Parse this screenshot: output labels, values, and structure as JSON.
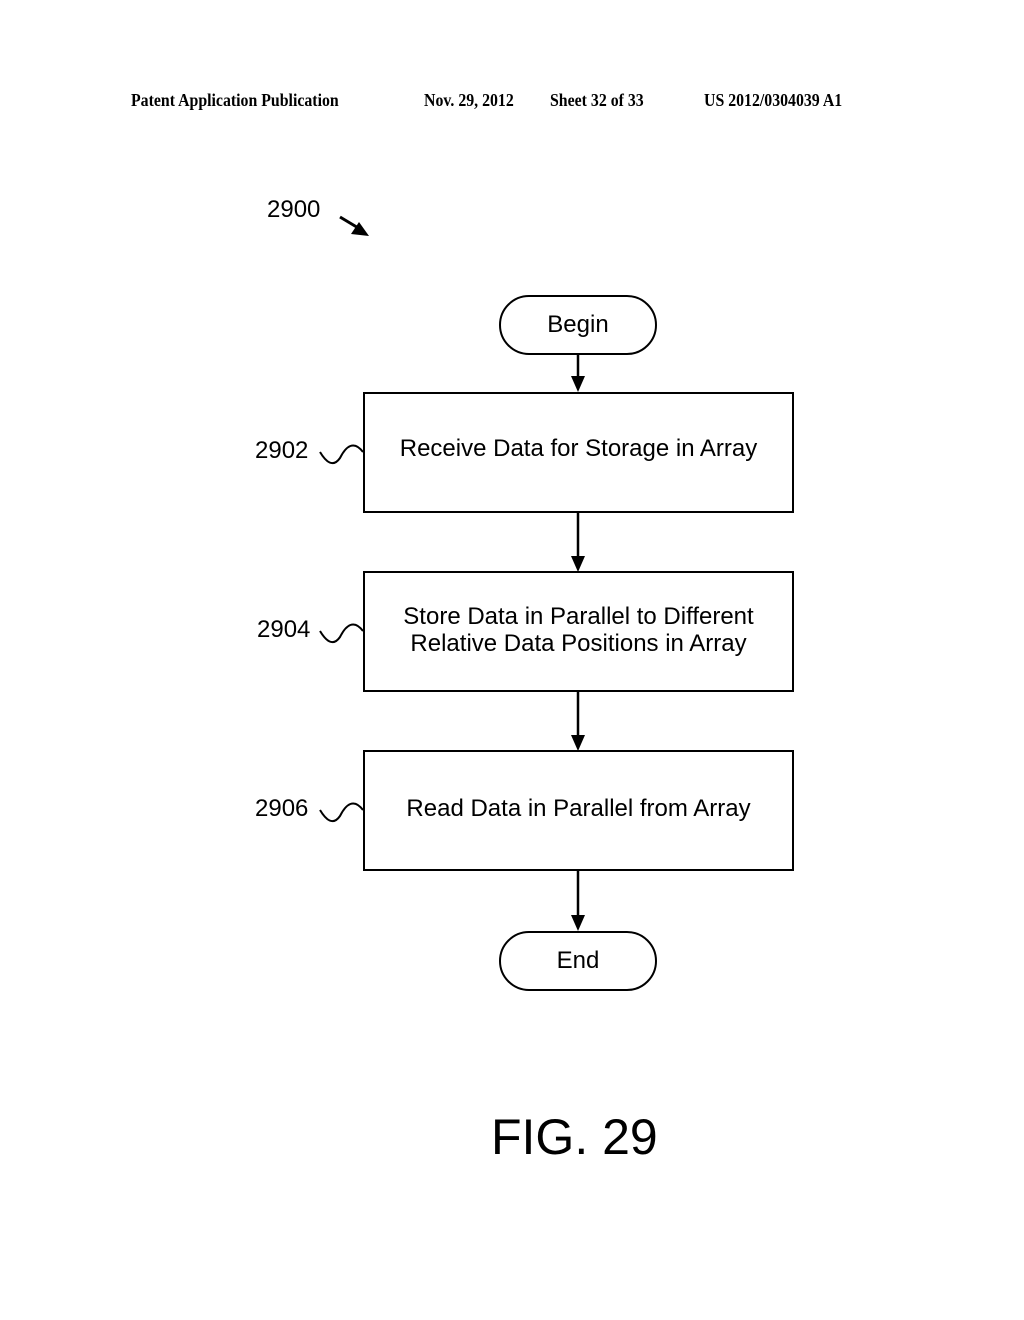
{
  "header": {
    "publication": "Patent Application Publication",
    "date": "Nov. 29, 2012",
    "sheet": "Sheet 32 of 33",
    "number": "US 2012/0304039 A1"
  },
  "figure": {
    "ref_label": "2900",
    "caption": "FIG. 29"
  },
  "flowchart": {
    "begin": "Begin",
    "end": "End",
    "steps": [
      {
        "ref": "2902",
        "lines": [
          "Receive Data for Storage in Array"
        ]
      },
      {
        "ref": "2904",
        "lines": [
          "Store Data in Parallel to Different",
          "Relative Data Positions in Array"
        ]
      },
      {
        "ref": "2906",
        "lines": [
          "Read Data in Parallel from Array"
        ]
      }
    ],
    "edges": [
      {
        "from": "begin",
        "to": "2902"
      },
      {
        "from": "2902",
        "to": "2904"
      },
      {
        "from": "2904",
        "to": "2906"
      },
      {
        "from": "2906",
        "to": "end"
      }
    ]
  }
}
